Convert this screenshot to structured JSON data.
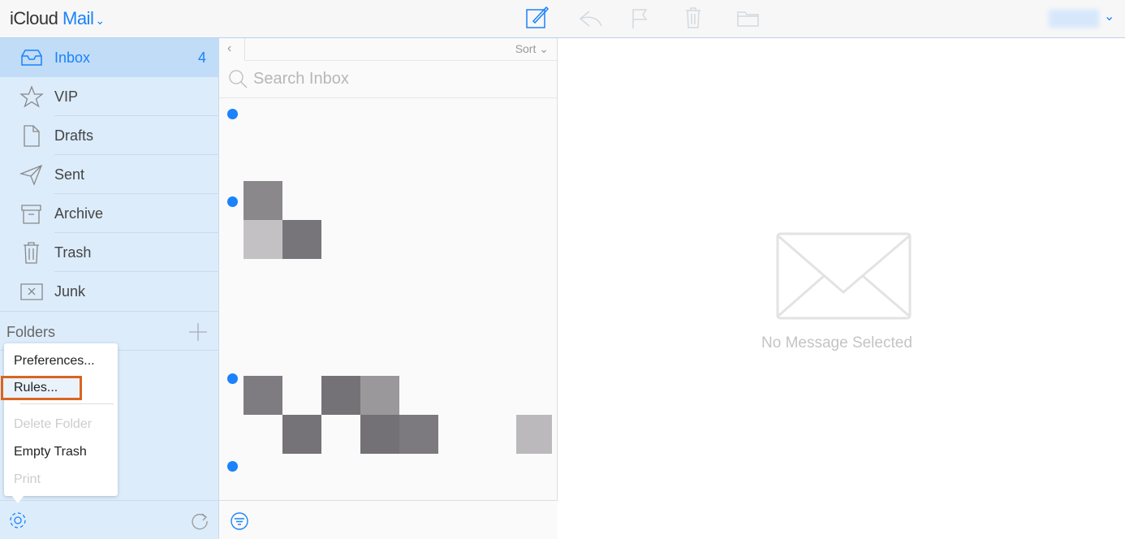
{
  "app": {
    "brand_prefix": "iCloud",
    "brand_app": "Mail"
  },
  "toolbar": {
    "icons": [
      "compose-icon",
      "reply-icon",
      "flag-icon",
      "trash-icon",
      "folder-icon"
    ]
  },
  "sidebar": {
    "items": [
      {
        "label": "Inbox",
        "count": "4",
        "icon": "inbox-icon",
        "selected": true
      },
      {
        "label": "VIP",
        "icon": "star-icon"
      },
      {
        "label": "Drafts",
        "icon": "document-icon"
      },
      {
        "label": "Sent",
        "icon": "paper-plane-icon"
      },
      {
        "label": "Archive",
        "icon": "archive-icon"
      },
      {
        "label": "Trash",
        "icon": "trash-icon"
      },
      {
        "label": "Junk",
        "icon": "junk-icon"
      }
    ],
    "folders_label": "Folders"
  },
  "settings_menu": {
    "items": [
      {
        "label": "Preferences...",
        "enabled": true
      },
      {
        "label": "Rules...",
        "enabled": true,
        "highlighted": true
      },
      {
        "label": "Delete Folder",
        "enabled": false
      },
      {
        "label": "Empty Trash",
        "enabled": true
      },
      {
        "label": "Print",
        "enabled": false
      }
    ]
  },
  "list": {
    "sort_label": "Sort",
    "search_placeholder": "Search Inbox"
  },
  "reader": {
    "empty_text": "No Message Selected"
  },
  "colors": {
    "accent": "#1a82fb",
    "highlight": "#d9651f",
    "sidebar": "#dcecfb"
  }
}
